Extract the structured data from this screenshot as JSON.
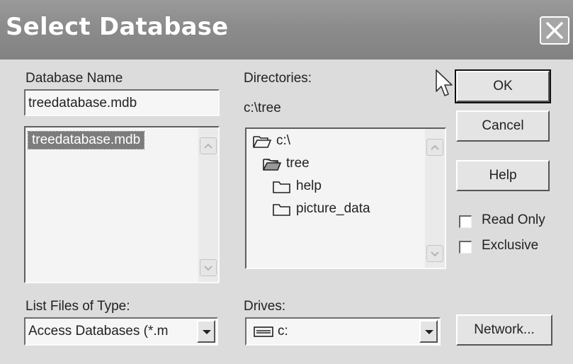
{
  "window": {
    "title": "Select Database"
  },
  "database_name": {
    "label": "Database Name",
    "value": "treedatabase.mdb"
  },
  "file_list": {
    "items": [
      "treedatabase.mdb"
    ],
    "selected": "treedatabase.mdb"
  },
  "directories": {
    "label": "Directories:",
    "current_path": "c:\\tree",
    "tree": [
      {
        "label": "c:\\",
        "icon": "open-folder-icon"
      },
      {
        "label": "tree",
        "icon": "open-folder-icon"
      },
      {
        "label": "help",
        "icon": "folder-icon"
      },
      {
        "label": "picture_data",
        "icon": "folder-icon"
      }
    ]
  },
  "file_type": {
    "label": "List Files of Type:",
    "value": "Access Databases (*.m"
  },
  "drives": {
    "label": "Drives:",
    "value": "c:"
  },
  "buttons": {
    "ok": "OK",
    "cancel": "Cancel",
    "help": "Help",
    "network": "Network..."
  },
  "options": {
    "read_only": "Read Only",
    "exclusive": "Exclusive"
  }
}
